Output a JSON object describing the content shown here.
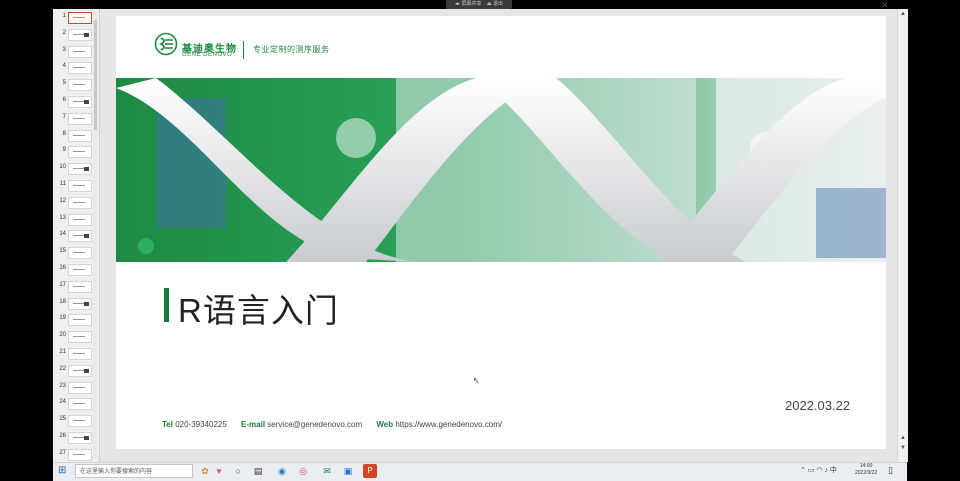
{
  "topbar": {
    "left": "◂▸ 屏幕共享",
    "right": "⏏ 退出"
  },
  "thumbnails": {
    "numbers": [
      "1",
      "2",
      "3",
      "4",
      "5",
      "6",
      "7",
      "8",
      "9",
      "10",
      "11",
      "12",
      "13",
      "14",
      "15",
      "16",
      "17",
      "18",
      "19",
      "20",
      "21",
      "22",
      "23",
      "24",
      "25",
      "26",
      "27"
    ],
    "selected_index": 0
  },
  "slide": {
    "logo_cn": "基迪奥生物",
    "logo_en": "GENE DENOVO",
    "slogan": "专业定制的测序服务",
    "title": "R语言入门",
    "date": "2022.03.22",
    "footer": {
      "tel_label": "Tel",
      "tel_value": "020-39340225",
      "email_label": "E-mail",
      "email_value": "service@genedenovo.com",
      "web_label": "Web",
      "web_value": "https://www.genedenovo.com/"
    }
  },
  "taskbar": {
    "search_placeholder": "在这里输入你要搜索的内容",
    "tray_lang": "中",
    "clock_time": "14:00",
    "clock_date": "2022/3/22"
  },
  "colors": {
    "brand_green": "#1e8a3e",
    "title_bar": "#1e7a3a",
    "selected_thumb": "#d24726"
  }
}
